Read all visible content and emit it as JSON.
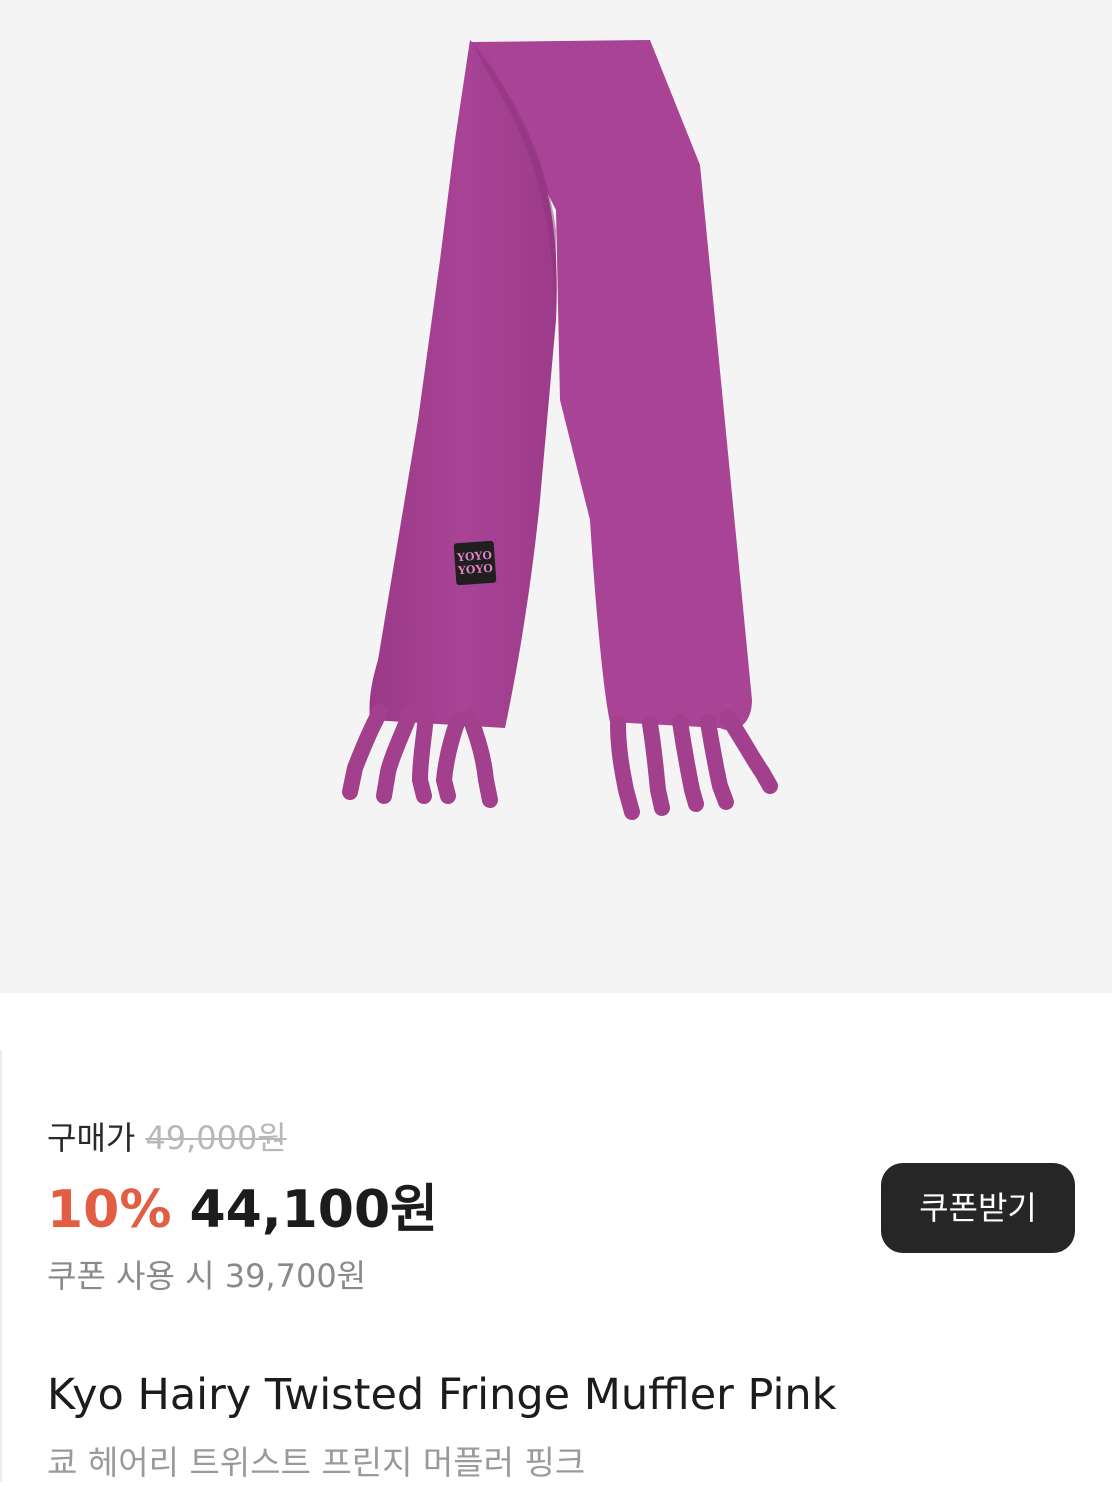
{
  "product": {
    "image_icon": "scarf-product-photo-icon",
    "label_text": "YOYO YOYO",
    "scarf_color": "#a3408e",
    "image_background": "#f4f4f4"
  },
  "price": {
    "purchase_label": "구매가",
    "original_price": "49,000원",
    "discount_rate": "10%",
    "sale_price": "44,100원",
    "coupon_price_note": "쿠폰 사용 시 39,700원",
    "discount_color": "#e35d43"
  },
  "coupon_button": {
    "label": "쿠폰받기",
    "color": "#262626"
  },
  "name": {
    "en": "Kyo Hairy Twisted Fringe Muffler Pink",
    "ko": "쿄 헤어리 트위스트 프린지 머플러 핑크"
  }
}
